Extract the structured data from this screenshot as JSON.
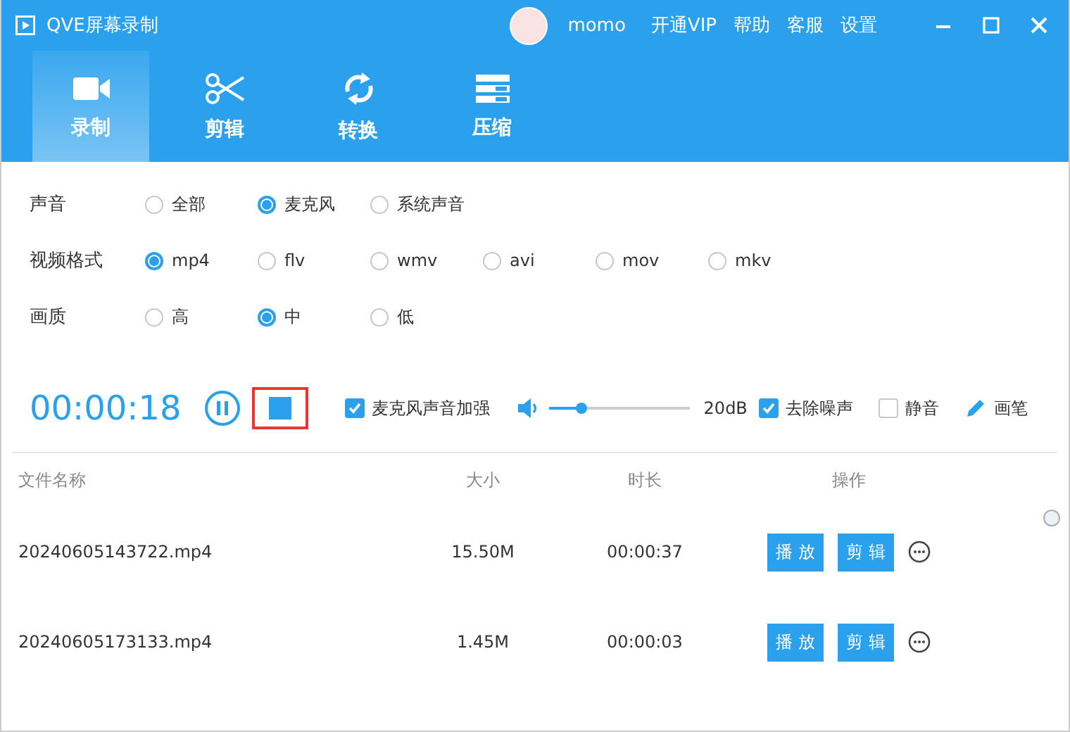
{
  "window": {
    "title": "QVE屏幕录制"
  },
  "user": {
    "name": "momo"
  },
  "menu": [
    "开通VIP",
    "帮助",
    "客服",
    "设置"
  ],
  "tabs": [
    {
      "label": "录制",
      "kind": "camera",
      "selected": true
    },
    {
      "label": "剪辑",
      "kind": "scissors",
      "selected": false
    },
    {
      "label": "转换",
      "kind": "refresh",
      "selected": false
    },
    {
      "label": "压缩",
      "kind": "stack",
      "selected": false
    }
  ],
  "option_groups": [
    {
      "label": "声音",
      "options": [
        {
          "label": "全部",
          "selected": false
        },
        {
          "label": "麦克风",
          "selected": true
        },
        {
          "label": "系统声音",
          "selected": false
        }
      ]
    },
    {
      "label": "视频格式",
      "options": [
        {
          "label": "mp4",
          "selected": true
        },
        {
          "label": "flv",
          "selected": false
        },
        {
          "label": "wmv",
          "selected": false
        },
        {
          "label": "avi",
          "selected": false
        },
        {
          "label": "mov",
          "selected": false
        },
        {
          "label": "mkv",
          "selected": false
        }
      ]
    },
    {
      "label": "画质",
      "options": [
        {
          "label": "高",
          "selected": false
        },
        {
          "label": "中",
          "selected": true
        },
        {
          "label": "低",
          "selected": false
        }
      ]
    }
  ],
  "recorder": {
    "time": "00:00:18",
    "stop_highlighted": true,
    "controls": [
      {
        "kind": "checkbox",
        "label": "麦克风声音加强",
        "checked": true
      },
      {
        "kind": "slider",
        "level": 0.23,
        "reading": "20dB"
      },
      {
        "kind": "checkbox",
        "label": "去除噪声",
        "checked": true
      },
      {
        "kind": "checkbox",
        "label": "静音",
        "checked": false
      },
      {
        "kind": "tool",
        "label": "画笔"
      }
    ]
  },
  "table": {
    "columns": [
      "文件名称",
      "大小",
      "时长",
      "操作"
    ],
    "rows": [
      {
        "name": "20240605143722.mp4",
        "size": "15.50M",
        "duration": "00:00:37",
        "actions": [
          "播 放",
          "剪 辑"
        ]
      },
      {
        "name": "20240605173133.mp4",
        "size": "1.45M",
        "duration": "00:00:03",
        "actions": [
          "播 放",
          "剪 辑"
        ]
      }
    ]
  }
}
